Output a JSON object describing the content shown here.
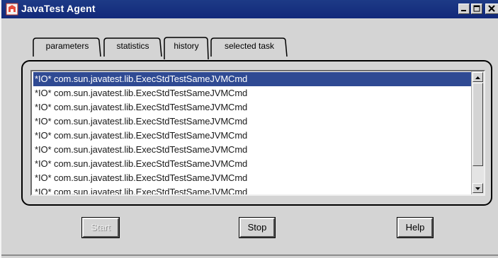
{
  "window": {
    "title": "JavaTest Agent",
    "icon": "javatest-app-icon",
    "controls": [
      "minimize-icon",
      "maximize-icon",
      "close-icon"
    ]
  },
  "tabs": [
    {
      "label": "parameters",
      "selected": false
    },
    {
      "label": "statistics",
      "selected": false
    },
    {
      "label": "history",
      "selected": true
    },
    {
      "label": "selected task",
      "selected": false
    }
  ],
  "history": {
    "items": [
      "*IO* com.sun.javatest.lib.ExecStdTestSameJVMCmd",
      "*IO* com.sun.javatest.lib.ExecStdTestSameJVMCmd",
      "*IO* com.sun.javatest.lib.ExecStdTestSameJVMCmd",
      "*IO* com.sun.javatest.lib.ExecStdTestSameJVMCmd",
      "*IO* com.sun.javatest.lib.ExecStdTestSameJVMCmd",
      "*IO* com.sun.javatest.lib.ExecStdTestSameJVMCmd",
      "*IO* com.sun.javatest.lib.ExecStdTestSameJVMCmd",
      "*IO* com.sun.javatest.lib.ExecStdTestSameJVMCmd",
      "*IO* com.sun.javatest.lib.ExecStdTestSameJVMCmd"
    ],
    "selected_index": 0
  },
  "buttons": {
    "start": {
      "label": "Start",
      "enabled": false
    },
    "stop": {
      "label": "Stop",
      "enabled": true
    },
    "help": {
      "label": "Help",
      "enabled": true
    }
  },
  "colors": {
    "titlebar": "#12297a",
    "selection": "#2f4a93",
    "window_bg": "#d4d4d4"
  }
}
